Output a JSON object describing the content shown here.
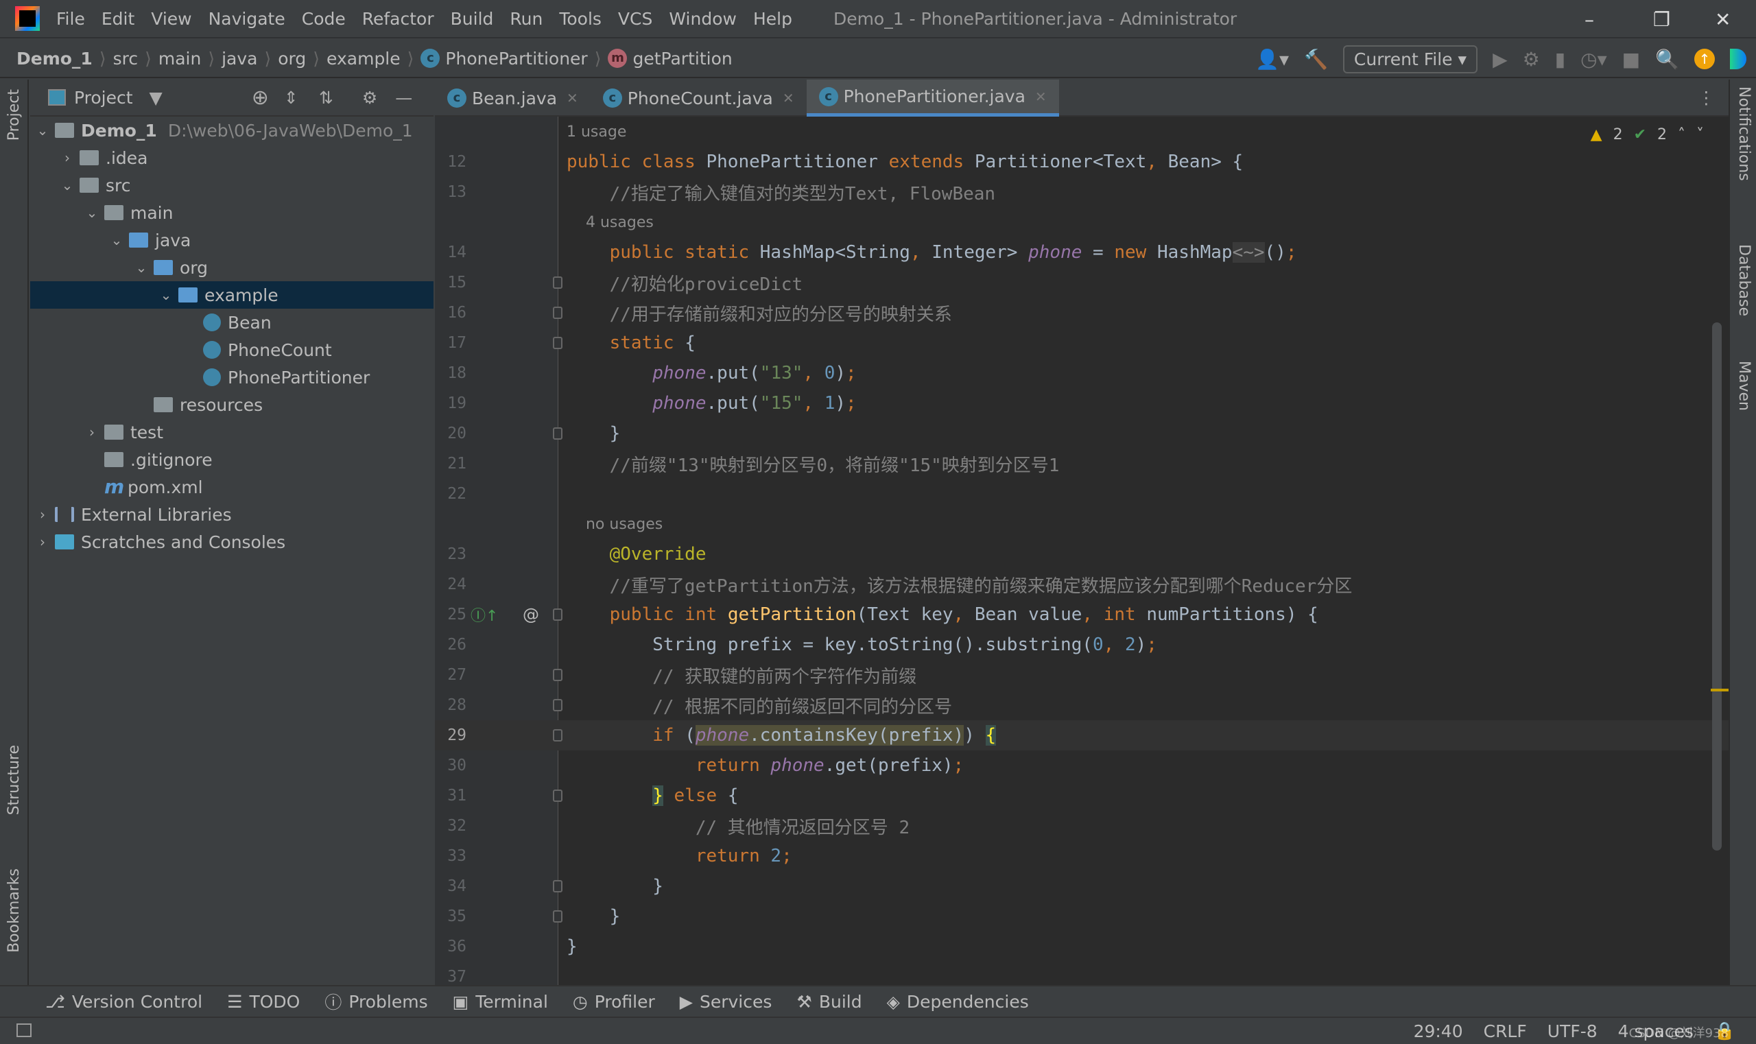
{
  "title": {
    "menu": [
      "File",
      "Edit",
      "View",
      "Navigate",
      "Code",
      "Refactor",
      "Build",
      "Run",
      "Tools",
      "VCS",
      "Window",
      "Help"
    ],
    "window_title": "Demo_1 - PhonePartitioner.java - Administrator"
  },
  "breadcrumb": [
    "Demo_1",
    "src",
    "main",
    "java",
    "org",
    "example",
    "PhonePartitioner",
    "getPartition"
  ],
  "toolbar": {
    "run_config": "Current File"
  },
  "left_stripe": [
    "Project",
    "Structure",
    "Bookmarks"
  ],
  "right_stripe": [
    "Notifications",
    "Database",
    "Maven"
  ],
  "project": {
    "title": "Project",
    "tree": [
      {
        "label": "Demo_1",
        "path": "D:\\web\\06-JavaWeb\\Demo_1",
        "level": 0,
        "chev": "down",
        "icon": "module-folder-icon",
        "bold": true
      },
      {
        "label": ".idea",
        "level": 1,
        "chev": "right",
        "icon": "folder-icon"
      },
      {
        "label": "src",
        "level": 1,
        "chev": "down",
        "icon": "folder-icon"
      },
      {
        "label": "main",
        "level": 2,
        "chev": "down",
        "icon": "folder-icon"
      },
      {
        "label": "java",
        "level": 3,
        "chev": "down",
        "icon": "source-folder-icon"
      },
      {
        "label": "org",
        "level": 4,
        "chev": "down",
        "icon": "package-icon"
      },
      {
        "label": "example",
        "level": 5,
        "chev": "down",
        "icon": "package-icon",
        "selected": true
      },
      {
        "label": "Bean",
        "level": 6,
        "icon": "class-icon"
      },
      {
        "label": "PhoneCount",
        "level": 6,
        "icon": "class-icon"
      },
      {
        "label": "PhonePartitioner",
        "level": 6,
        "icon": "class-icon"
      },
      {
        "label": "resources",
        "level": 4,
        "icon": "resources-folder-icon"
      },
      {
        "label": "test",
        "level": 2,
        "chev": "right",
        "icon": "folder-icon"
      },
      {
        "label": ".gitignore",
        "level": 2,
        "icon": "gitignore-icon"
      },
      {
        "label": "pom.xml",
        "level": 2,
        "icon": "maven-icon"
      },
      {
        "label": "External Libraries",
        "level": 0,
        "chev": "right",
        "icon": "library-icon"
      },
      {
        "label": "Scratches and Consoles",
        "level": 0,
        "chev": "right",
        "icon": "scratches-icon"
      }
    ]
  },
  "tabs": [
    {
      "label": "Bean.java"
    },
    {
      "label": "PhoneCount.java"
    },
    {
      "label": "PhonePartitioner.java",
      "active": true
    }
  ],
  "inspections": {
    "warnings": "2",
    "weak_warnings": "2"
  },
  "code": [
    {
      "hint": "1 usage"
    },
    {
      "n": "12",
      "tokens": [
        [
          "public class ",
          "kw"
        ],
        [
          "PhonePartitioner ",
          "t"
        ],
        [
          "extends ",
          "kw"
        ],
        [
          "Partitioner<Text",
          "t"
        ],
        [
          ", ",
          "kw"
        ],
        [
          "Bean> {",
          "t"
        ]
      ]
    },
    {
      "n": "13",
      "tokens": [
        [
          "    //指定了输入键值对的类型为Text, FlowBean",
          "cm"
        ]
      ]
    },
    {
      "hint": "    4 usages"
    },
    {
      "n": "14",
      "tokens": [
        [
          "    public static ",
          "kw"
        ],
        [
          "HashMap<String",
          "t"
        ],
        [
          ", ",
          "kw"
        ],
        [
          "Integer> ",
          "t"
        ],
        [
          "phone",
          "fld"
        ],
        [
          " = ",
          "t"
        ],
        [
          "new ",
          "kw"
        ],
        [
          "HashMap",
          "t"
        ],
        [
          "<~>",
          "foldph"
        ],
        [
          "()",
          "t"
        ],
        [
          ";",
          "kw"
        ]
      ]
    },
    {
      "n": "15",
      "fold": true,
      "tokens": [
        [
          "    //初始化proviceDict",
          "cm"
        ]
      ]
    },
    {
      "n": "16",
      "fold": true,
      "tokens": [
        [
          "    //用于存储前缀和对应的分区号的映射关系",
          "cm"
        ]
      ]
    },
    {
      "n": "17",
      "fold": true,
      "tokens": [
        [
          "    static ",
          "kw"
        ],
        [
          "{",
          "t"
        ]
      ]
    },
    {
      "n": "18",
      "tokens": [
        [
          "        ",
          "t"
        ],
        [
          "phone",
          "fld"
        ],
        [
          ".put(",
          "t"
        ],
        [
          "\"13\"",
          "str"
        ],
        [
          ", ",
          "kw"
        ],
        [
          "0",
          "num"
        ],
        [
          ")",
          "t"
        ],
        [
          ";",
          "kw"
        ]
      ]
    },
    {
      "n": "19",
      "tokens": [
        [
          "        ",
          "t"
        ],
        [
          "phone",
          "fld"
        ],
        [
          ".put(",
          "t"
        ],
        [
          "\"15\"",
          "str"
        ],
        [
          ", ",
          "kw"
        ],
        [
          "1",
          "num"
        ],
        [
          ")",
          "t"
        ],
        [
          ";",
          "kw"
        ]
      ]
    },
    {
      "n": "20",
      "fold": true,
      "tokens": [
        [
          "    }",
          "t"
        ]
      ]
    },
    {
      "n": "21",
      "tokens": [
        [
          "    //前缀\"13\"映射到分区号0，将前缀\"15\"映射到分区号1",
          "cm"
        ]
      ]
    },
    {
      "n": "22",
      "tokens": []
    },
    {
      "hint": "    no usages"
    },
    {
      "n": "23",
      "tokens": [
        [
          "    @Override",
          "ann"
        ]
      ]
    },
    {
      "n": "24",
      "tokens": [
        [
          "    //重写了getPartition方法，该方法根据键的前缀来确定数据应该分配到哪个Reducer分区",
          "cm"
        ]
      ]
    },
    {
      "n": "25",
      "fold": true,
      "gutter_icons": [
        "implements-method-icon",
        "at-icon"
      ],
      "tokens": [
        [
          "    public int ",
          "kw"
        ],
        [
          "getPartition",
          "mth"
        ],
        [
          "(Text key",
          "t"
        ],
        [
          ", ",
          "kw"
        ],
        [
          "Bean value",
          "t"
        ],
        [
          ", ",
          "kw"
        ],
        [
          "int ",
          "kw"
        ],
        [
          "numPartitions) {",
          "t"
        ]
      ]
    },
    {
      "n": "26",
      "tokens": [
        [
          "        String prefix = key.toString().substring(",
          "t"
        ],
        [
          "0",
          "num"
        ],
        [
          ", ",
          "kw"
        ],
        [
          "2",
          "num"
        ],
        [
          ")",
          "t"
        ],
        [
          ";",
          "kw"
        ]
      ]
    },
    {
      "n": "27",
      "fold": true,
      "tokens": [
        [
          "        // 获取键的前两个字符作为前缀",
          "cm"
        ]
      ]
    },
    {
      "n": "28",
      "fold": true,
      "tokens": [
        [
          "        // 根据不同的前缀返回不同的分区号",
          "cm"
        ]
      ]
    },
    {
      "n": "29",
      "fold": true,
      "current": true,
      "tokens": [
        [
          "        if ",
          "kw"
        ],
        [
          "(",
          "t"
        ],
        [
          "phone",
          "fld hl"
        ],
        [
          ".containsKey(prefix)",
          "t hl"
        ],
        [
          ") ",
          "t"
        ],
        [
          "{",
          "brace"
        ]
      ]
    },
    {
      "n": "30",
      "tokens": [
        [
          "            return ",
          "kw"
        ],
        [
          "phone",
          "fld"
        ],
        [
          ".get(prefix)",
          "t"
        ],
        [
          ";",
          "kw"
        ]
      ]
    },
    {
      "n": "31",
      "fold": true,
      "tokens": [
        [
          "        ",
          "t"
        ],
        [
          "}",
          "brace"
        ],
        [
          " else ",
          "kw"
        ],
        [
          "{",
          "t"
        ]
      ]
    },
    {
      "n": "32",
      "tokens": [
        [
          "            // 其他情况返回分区号 2",
          "cm"
        ]
      ]
    },
    {
      "n": "33",
      "tokens": [
        [
          "            return ",
          "kw"
        ],
        [
          "2",
          "num"
        ],
        [
          ";",
          "kw"
        ]
      ]
    },
    {
      "n": "34",
      "fold": true,
      "tokens": [
        [
          "        }",
          "t"
        ]
      ]
    },
    {
      "n": "35",
      "fold": true,
      "tokens": [
        [
          "    }",
          "t"
        ]
      ]
    },
    {
      "n": "36",
      "tokens": [
        [
          "}",
          "t"
        ]
      ]
    },
    {
      "n": "37",
      "tokens": []
    }
  ],
  "bottom_tools": [
    "Version Control",
    "TODO",
    "Problems",
    "Terminal",
    "Profiler",
    "Services",
    "Build",
    "Dependencies"
  ],
  "status": {
    "position": "29:40",
    "line_separator": "CRLF",
    "encoding": "UTF-8",
    "indent": "4 spaces"
  },
  "watermark": "CSDN @刘洋938"
}
